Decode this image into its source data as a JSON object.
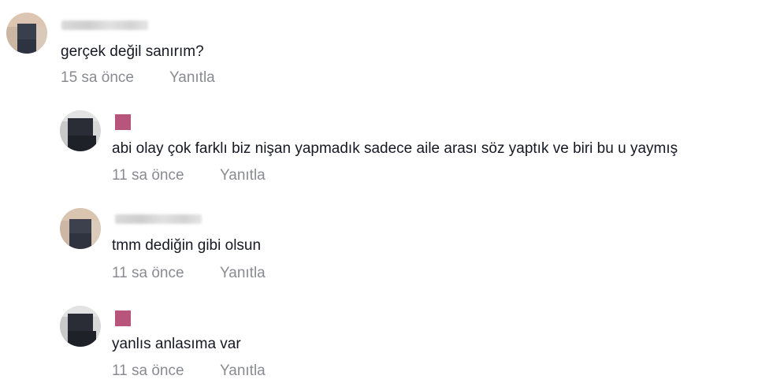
{
  "comments": [
    {
      "text": "gerçek değil sanırım?",
      "time": "15 sa önce",
      "reply_label": "Yanıtla"
    },
    {
      "text": "abi olay çok farklı biz nişan yapmadık sadece aile arası söz yaptık ve biri bu u yaymış",
      "time": "11 sa önce",
      "reply_label": "Yanıtla"
    },
    {
      "text": "tmm dediğin gibi olsun",
      "time": "11 sa önce",
      "reply_label": "Yanıtla"
    },
    {
      "text": "yanlıs anlasıma var",
      "time": "11 sa önce",
      "reply_label": "Yanıtla"
    }
  ],
  "colors": {
    "text": "#161823",
    "muted": "#8a8b91",
    "badge": "#b8557c"
  },
  "icons": {
    "avatar_style": "pixelated-blurred-avatar"
  }
}
